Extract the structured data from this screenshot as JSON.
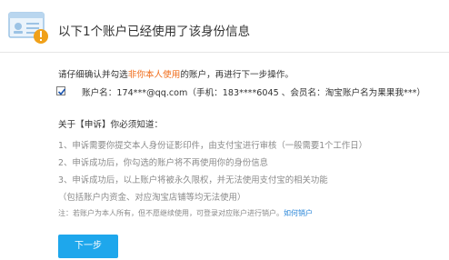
{
  "header": {
    "title": "以下1个账户已经使用了该身份信息",
    "icon": "id-card-warning-icon",
    "accent_color": "#f0a11a"
  },
  "instruction": {
    "prefix": "请仔细确认并勾选",
    "highlight": "非你本人使用",
    "suffix": "的账户，再进行下一步操作。",
    "highlight_color": "#f06c1a"
  },
  "account": {
    "checked": true,
    "text": "账户名：174***@qq.com（手机：183****6045 、会员名：淘宝账户名为果果我***）"
  },
  "notice": {
    "title": "关于【申诉】你必须知道：",
    "items": [
      "1、申诉需要你提交本人身份证影印件，由支付宝进行审核（一般需要1个工作日）",
      "2、申诉成功后，你勾选的账户将不再使用你的身份信息",
      "3、申诉成功后，以上账户将被永久限权，并无法使用支付宝的相关功能",
      "（包括账户内资金、对应淘宝店铺等均无法使用）"
    ]
  },
  "note": {
    "text": "注：若账户为本人所有，但不愿继续使用，可登录对应账户进行销户。",
    "link": "如何销户",
    "link_color": "#2a86d8"
  },
  "next_button": {
    "label": "下一步",
    "color": "#1ea7ec"
  }
}
